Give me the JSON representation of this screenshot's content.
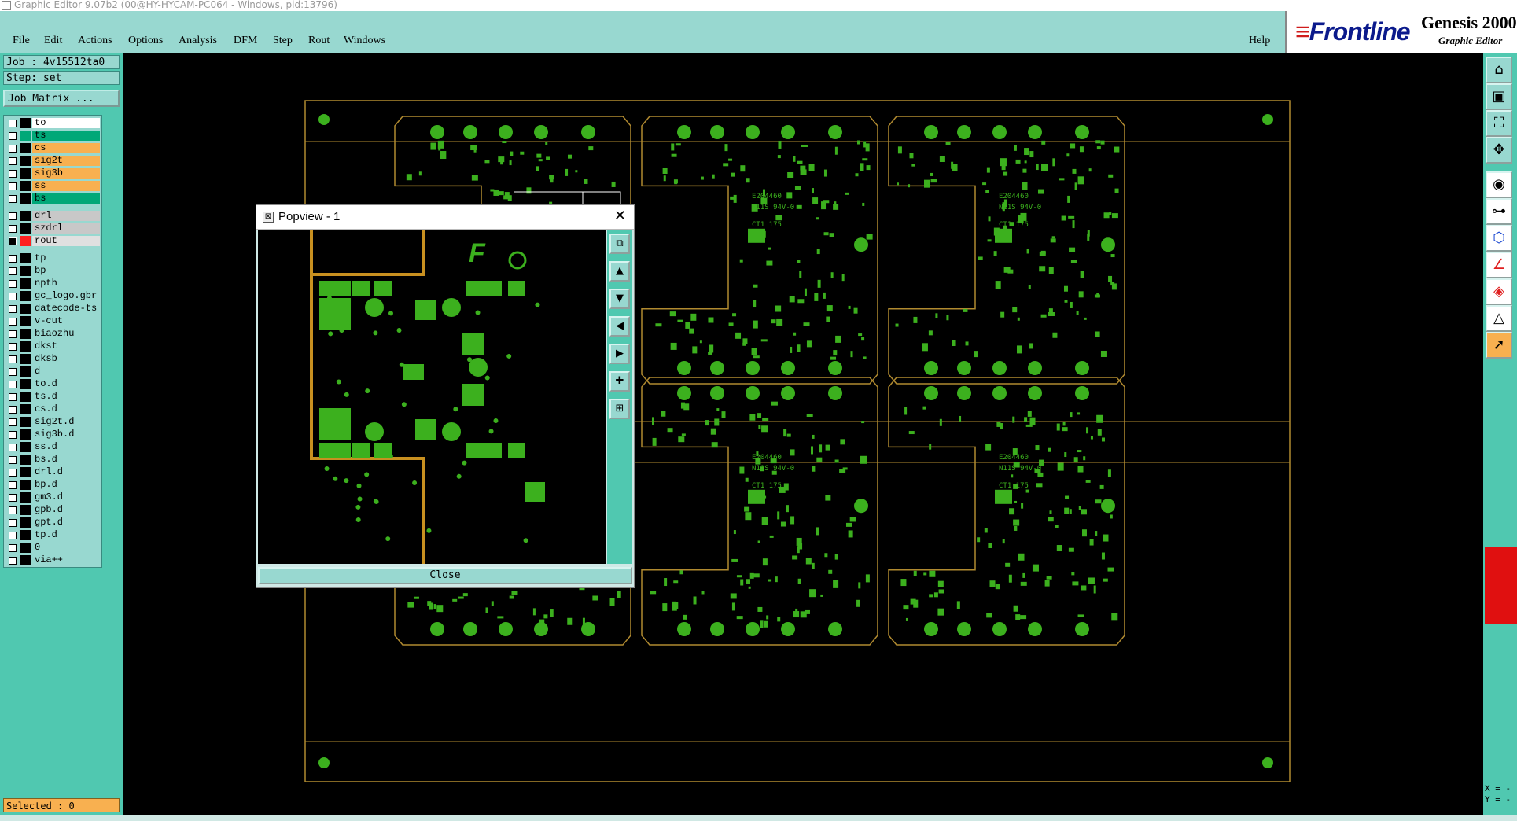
{
  "window_title": "Graphic Editor 9.07b2 (00@HY-HYCAM-PC064 - Windows, pid:13796)",
  "menu": [
    "File",
    "Edit",
    "Actions",
    "Options",
    "Analysis",
    "DFM",
    "Step",
    "Rout",
    "Windows"
  ],
  "help_label": "Help",
  "brand": {
    "logo": "Frontline",
    "product": "Genesis 2000",
    "subtitle": "Graphic Editor"
  },
  "job": {
    "job_label": "Job : 4v15512ta0",
    "step_label": "Step: set",
    "matrix_button": "Job Matrix ..."
  },
  "layer_groups": [
    [
      {
        "name": "to",
        "color": "#ffffff",
        "swatch": "#000000",
        "checked": false
      },
      {
        "name": "ts",
        "color": "#00a878",
        "swatch": "#00a878",
        "checked": false
      },
      {
        "name": "cs",
        "color": "#f8b050",
        "swatch": "#000000",
        "checked": false
      },
      {
        "name": "sig2t",
        "color": "#f8b050",
        "swatch": "#000000",
        "checked": false
      },
      {
        "name": "sig3b",
        "color": "#f8b050",
        "swatch": "#000000",
        "checked": false
      },
      {
        "name": "ss",
        "color": "#f8b050",
        "swatch": "#000000",
        "checked": false
      },
      {
        "name": "bs",
        "color": "#00a878",
        "swatch": "#000000",
        "checked": false
      }
    ],
    [
      {
        "name": "drl",
        "color": "#c8c8c8",
        "swatch": "#000000",
        "checked": false
      },
      {
        "name": "szdrl",
        "color": "#c8c8c8",
        "swatch": "#000000",
        "checked": false
      },
      {
        "name": "rout",
        "color": "#e0e0e0",
        "swatch": "#ff2020",
        "checked": true
      }
    ],
    [
      {
        "name": "tp",
        "color": "#98d8d0",
        "swatch": "#000000",
        "checked": false
      },
      {
        "name": "bp",
        "color": "#98d8d0",
        "swatch": "#000000",
        "checked": false
      },
      {
        "name": "npth",
        "color": "#98d8d0",
        "swatch": "#000000",
        "checked": false
      },
      {
        "name": "gc_logo.gbr",
        "color": "#98d8d0",
        "swatch": "#000000",
        "checked": false
      },
      {
        "name": "datecode-ts",
        "color": "#98d8d0",
        "swatch": "#000000",
        "checked": false
      },
      {
        "name": "v-cut",
        "color": "#98d8d0",
        "swatch": "#000000",
        "checked": false
      },
      {
        "name": "biaozhu",
        "color": "#98d8d0",
        "swatch": "#000000",
        "checked": false
      },
      {
        "name": "dkst",
        "color": "#98d8d0",
        "swatch": "#000000",
        "checked": false
      },
      {
        "name": "dksb",
        "color": "#98d8d0",
        "swatch": "#000000",
        "checked": false
      },
      {
        "name": "d",
        "color": "#98d8d0",
        "swatch": "#000000",
        "checked": false
      },
      {
        "name": "to.d",
        "color": "#98d8d0",
        "swatch": "#000000",
        "checked": false
      },
      {
        "name": "ts.d",
        "color": "#98d8d0",
        "swatch": "#000000",
        "checked": false
      },
      {
        "name": "cs.d",
        "color": "#98d8d0",
        "swatch": "#000000",
        "checked": false
      },
      {
        "name": "sig2t.d",
        "color": "#98d8d0",
        "swatch": "#000000",
        "checked": false
      },
      {
        "name": "sig3b.d",
        "color": "#98d8d0",
        "swatch": "#000000",
        "checked": false
      },
      {
        "name": "ss.d",
        "color": "#98d8d0",
        "swatch": "#000000",
        "checked": false
      },
      {
        "name": "bs.d",
        "color": "#98d8d0",
        "swatch": "#000000",
        "checked": false
      },
      {
        "name": "drl.d",
        "color": "#98d8d0",
        "swatch": "#000000",
        "checked": false
      },
      {
        "name": "bp.d",
        "color": "#98d8d0",
        "swatch": "#000000",
        "checked": false
      },
      {
        "name": "gm3.d",
        "color": "#98d8d0",
        "swatch": "#000000",
        "checked": false
      },
      {
        "name": "gpb.d",
        "color": "#98d8d0",
        "swatch": "#000000",
        "checked": false
      },
      {
        "name": "gpt.d",
        "color": "#98d8d0",
        "swatch": "#000000",
        "checked": false
      },
      {
        "name": "tp.d",
        "color": "#98d8d0",
        "swatch": "#000000",
        "checked": false
      },
      {
        "name": "0",
        "color": "#98d8d0",
        "swatch": "#000000",
        "checked": false
      },
      {
        "name": "via++",
        "color": "#98d8d0",
        "swatch": "#000000",
        "checked": false
      }
    ]
  ],
  "selected_label": "Selected : 0",
  "popview": {
    "title": "Popview - 1",
    "close_label": "Close",
    "board_marks": [
      "E204460",
      "N11S 94V-0",
      "CT1 175"
    ]
  },
  "right_tools": [
    "zoom-home-icon",
    "zoom-window-icon",
    "fit-icon",
    "pan-icon",
    "snap-icon",
    "measure-icon",
    "net-icon",
    "angle-icon",
    "feature-icon",
    "highlight-icon",
    "select-pointer-icon"
  ],
  "coords": {
    "x_label": "X = -",
    "y_label": "Y = -"
  },
  "colors": {
    "panel": "#50c8b0",
    "light": "#98d8d0",
    "copper": "#3cb01e",
    "outline": "#b08a30"
  }
}
